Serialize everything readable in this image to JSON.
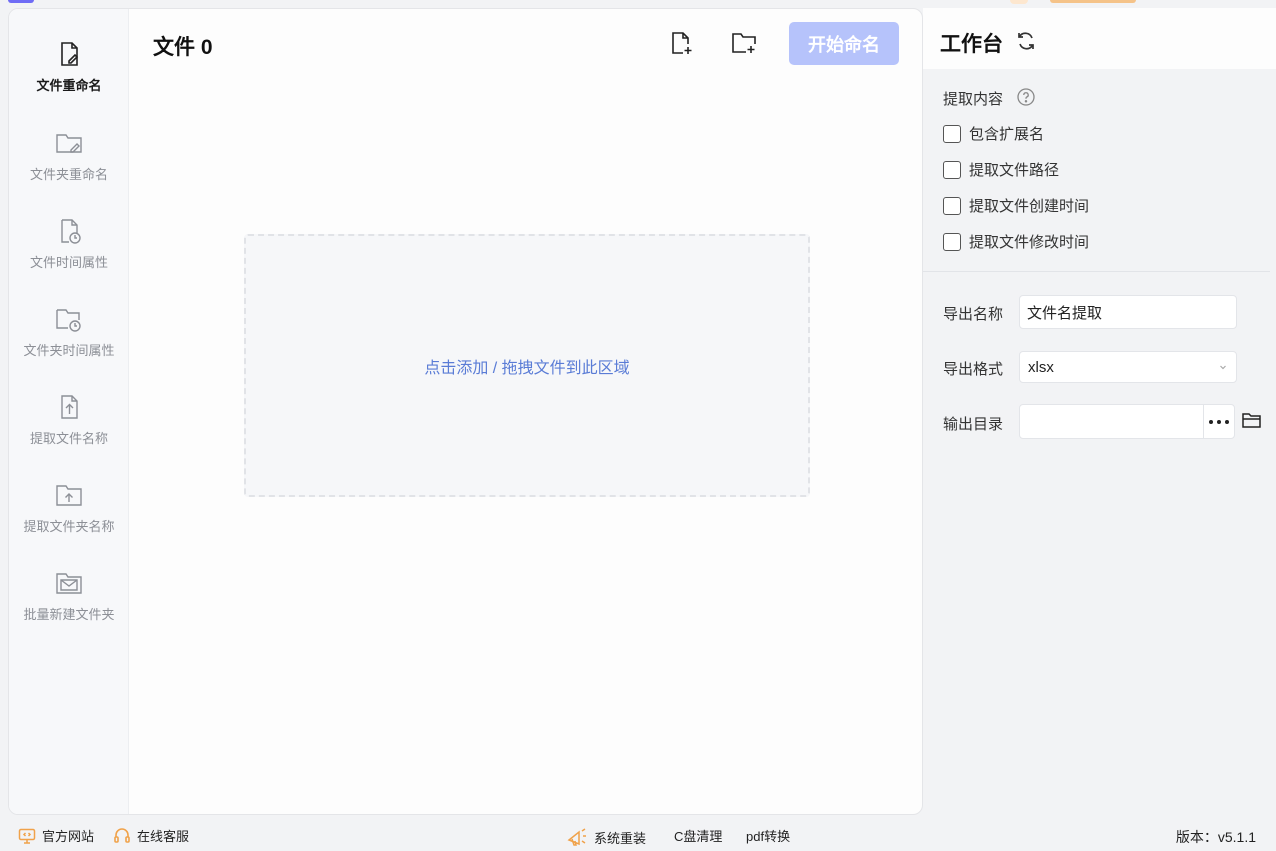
{
  "main": {
    "title": "文件 0",
    "start_button": "开始命名",
    "drop_zone_text": "点击添加 / 拖拽文件到此区域"
  },
  "sidebar": {
    "items": [
      {
        "label": "文件重命名",
        "icon": "file-edit-icon",
        "active": true
      },
      {
        "label": "文件夹重命名",
        "icon": "folder-edit-icon",
        "active": false
      },
      {
        "label": "文件时间属性",
        "icon": "file-clock-icon",
        "active": false
      },
      {
        "label": "文件夹时间属性",
        "icon": "folder-clock-icon",
        "active": false
      },
      {
        "label": "提取文件名称",
        "icon": "file-upload-icon",
        "active": false
      },
      {
        "label": "提取文件夹名称",
        "icon": "folder-upload-icon",
        "active": false
      },
      {
        "label": "批量新建文件夹",
        "icon": "folder-mail-icon",
        "active": false
      }
    ]
  },
  "workbench": {
    "title": "工作台",
    "extract_label": "提取内容",
    "options": [
      {
        "label": "包含扩展名",
        "checked": false
      },
      {
        "label": "提取文件路径",
        "checked": false
      },
      {
        "label": "提取文件创建时间",
        "checked": false
      },
      {
        "label": "提取文件修改时间",
        "checked": false
      }
    ],
    "export_name_label": "导出名称",
    "export_name_value": "文件名提取",
    "export_format_label": "导出格式",
    "export_format_value": "xlsx",
    "output_dir_label": "输出目录",
    "output_dir_value": ""
  },
  "footer": {
    "website": "官方网站",
    "support": "在线客服",
    "reinstall": "系统重装",
    "c_clean": "C盘清理",
    "pdf": "pdf转换",
    "version": "版本：v5.1.1"
  },
  "colors": {
    "accent_disabled": "#b6c3fb",
    "link_blue": "#5a7cd6",
    "footer_icon_orange": "#f0a24a"
  }
}
